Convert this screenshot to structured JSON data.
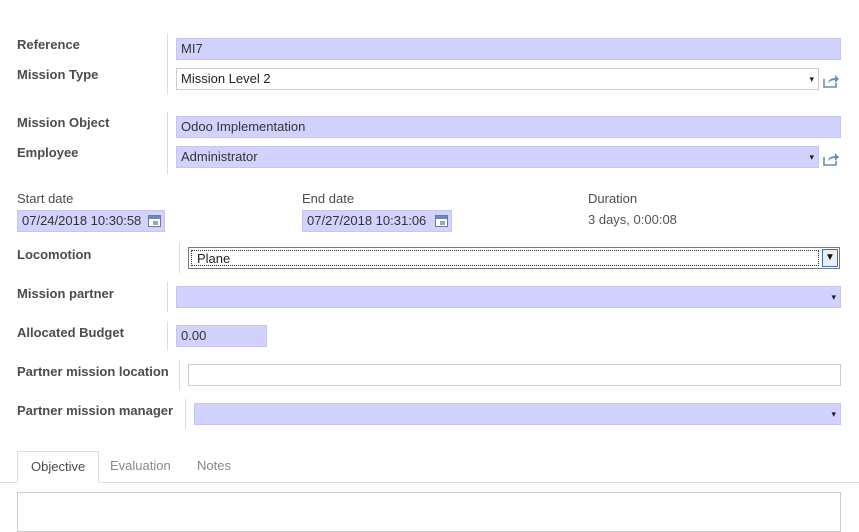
{
  "form": {
    "reference": {
      "label": "Reference",
      "value": "MI7"
    },
    "mission_type": {
      "label": "Mission Type",
      "value": "Mission Level 2"
    },
    "mission_object": {
      "label": "Mission Object",
      "value": "Odoo Implementation"
    },
    "employee": {
      "label": "Employee",
      "value": "Administrator"
    },
    "start_date": {
      "label": "Start date",
      "value": "07/24/2018 10:30:58"
    },
    "end_date": {
      "label": "End date",
      "value": "07/27/2018 10:31:06"
    },
    "duration": {
      "label": "Duration",
      "value": "3 days, 0:00:08"
    },
    "locomotion": {
      "label": "Locomotion",
      "value": "Plane"
    },
    "mission_partner": {
      "label": "Mission partner",
      "value": ""
    },
    "allocated_budget": {
      "label": "Allocated Budget",
      "value": "0.00"
    },
    "partner_mission_location": {
      "label": "Partner mission location",
      "value": ""
    },
    "partner_mission_manager": {
      "label": "Partner mission manager",
      "value": ""
    }
  },
  "tabs": [
    {
      "label": "Objective",
      "active": true
    },
    {
      "label": "Evaluation",
      "active": false
    },
    {
      "label": "Notes",
      "active": false
    }
  ],
  "colors": {
    "required_field_bg": "#d2d2ff"
  },
  "icons": {
    "dropdown": "▼",
    "dropdown_small": "▾"
  }
}
